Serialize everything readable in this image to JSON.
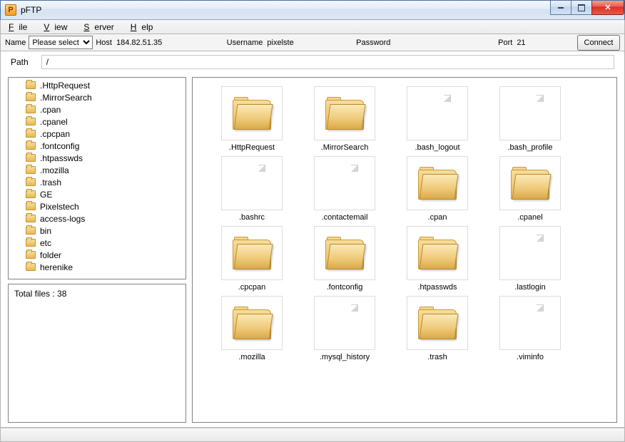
{
  "titlebar": {
    "app_icon_letter": "P",
    "title": "pFTP"
  },
  "menu": {
    "file": "File",
    "view": "View",
    "server": "Server",
    "help": "Help"
  },
  "conn": {
    "name_label": "Name",
    "name_select": "Please select",
    "host_label": "Host",
    "host_value": "184.82.51.35",
    "user_label": "Username",
    "user_value": "pixelste",
    "pass_label": "Password",
    "pass_value": "",
    "port_label": "Port",
    "port_value": "21",
    "connect": "Connect"
  },
  "path": {
    "label": "Path",
    "value": "/"
  },
  "tree": [
    ".HttpRequest",
    ".MirrorSearch",
    ".cpan",
    ".cpanel",
    ".cpcpan",
    ".fontconfig",
    ".htpasswds",
    ".mozilla",
    ".trash",
    "GE",
    "Pixelstech",
    "access-logs",
    "bin",
    "etc",
    "folder",
    "herenike"
  ],
  "info": {
    "total_label": "Total files :",
    "total_value": "38"
  },
  "grid": [
    {
      "name": ".HttpRequest",
      "type": "folder"
    },
    {
      "name": ".MirrorSearch",
      "type": "folder"
    },
    {
      "name": ".bash_logout",
      "type": "file"
    },
    {
      "name": ".bash_profile",
      "type": "file"
    },
    {
      "name": ".bashrc",
      "type": "file"
    },
    {
      "name": ".contactemail",
      "type": "file"
    },
    {
      "name": ".cpan",
      "type": "folder"
    },
    {
      "name": ".cpanel",
      "type": "folder"
    },
    {
      "name": ".cpcpan",
      "type": "folder"
    },
    {
      "name": ".fontconfig",
      "type": "folder"
    },
    {
      "name": ".htpasswds",
      "type": "folder"
    },
    {
      "name": ".lastlogin",
      "type": "file"
    },
    {
      "name": ".mozilla",
      "type": "folder"
    },
    {
      "name": ".mysql_history",
      "type": "file"
    },
    {
      "name": ".trash",
      "type": "folder"
    },
    {
      "name": ".viminfo",
      "type": "file"
    }
  ]
}
